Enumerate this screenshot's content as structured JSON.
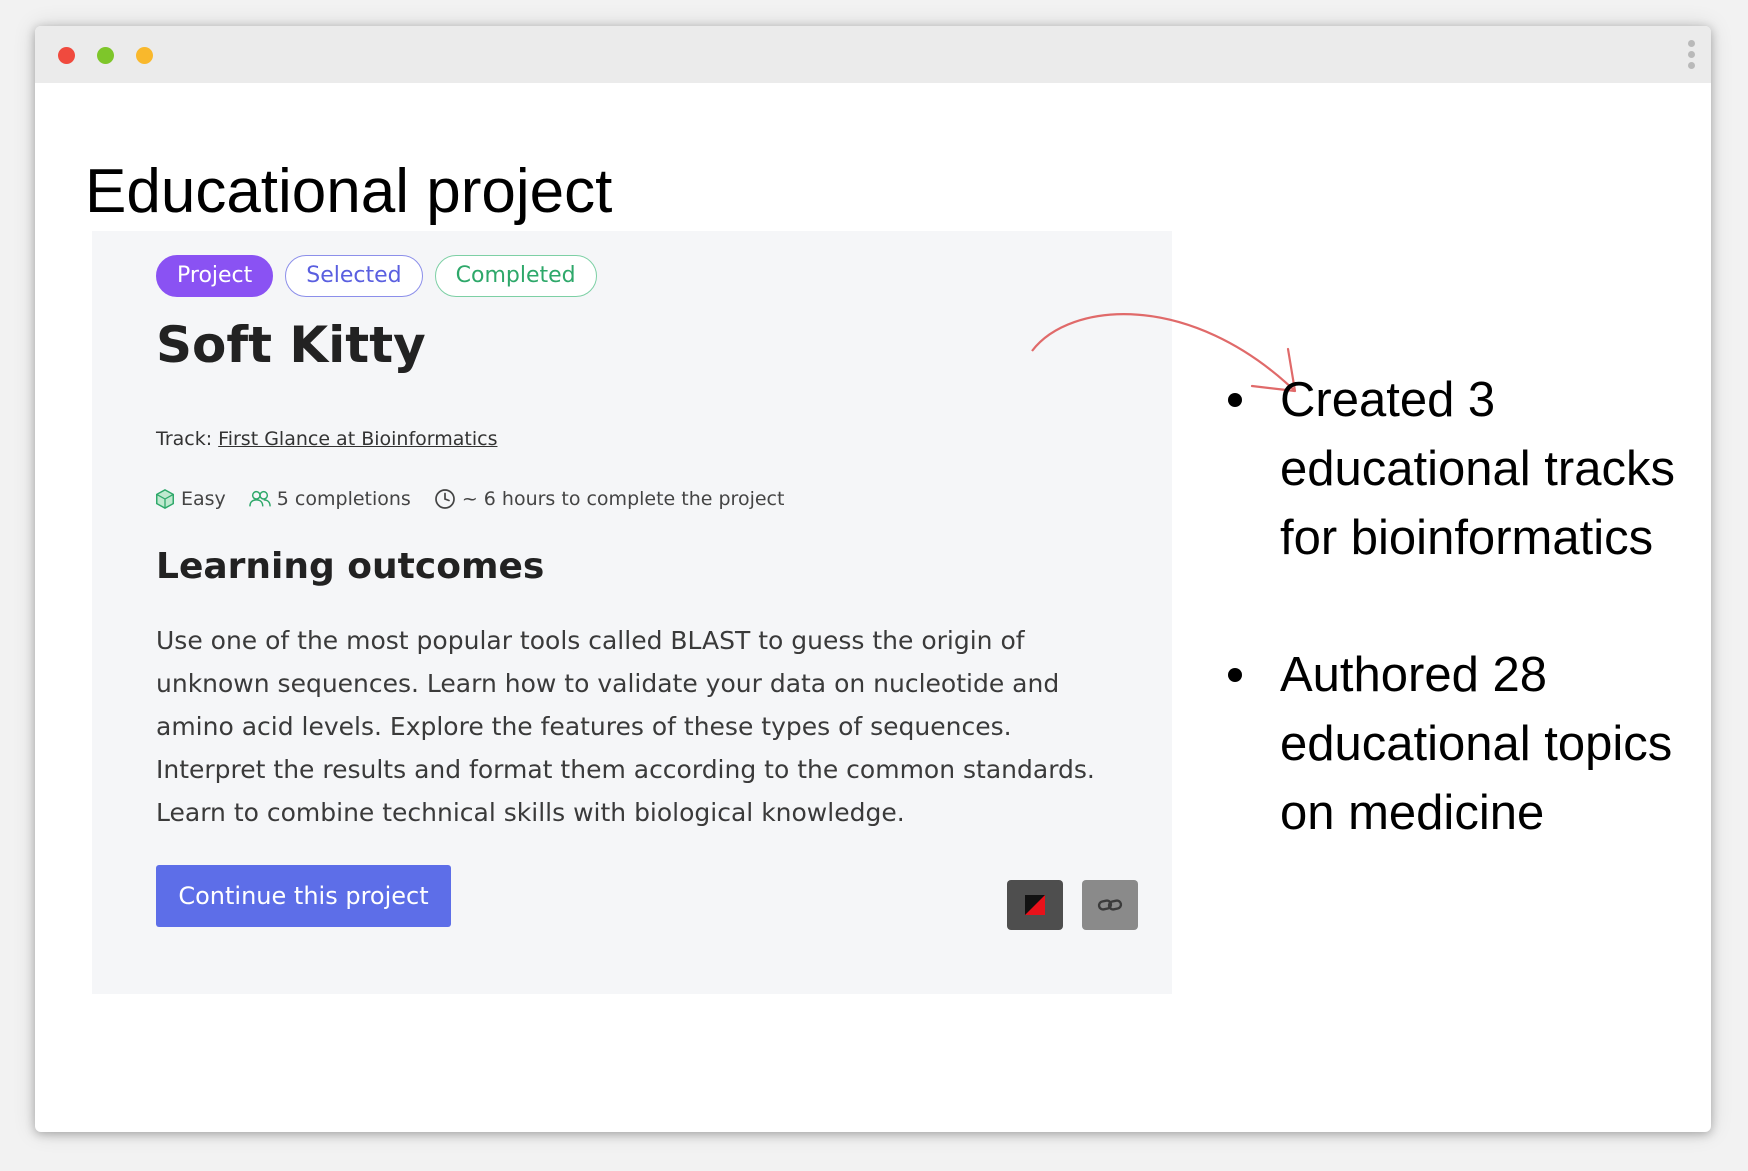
{
  "page": {
    "title": "Educational project"
  },
  "card": {
    "badges": [
      "Project",
      "Selected",
      "Completed"
    ],
    "title": "Soft Kitty",
    "track_label": "Track:",
    "track_link": "First Glance at Bioinformatics",
    "meta": {
      "difficulty": "Easy",
      "completions": "5 completions",
      "duration": "~ 6 hours to complete the project"
    },
    "outcomes_heading": "Learning outcomes",
    "outcomes_text": "Use one of the most popular tools called BLAST to guess the origin of unknown sequences. Learn how to validate your data on nucleotide and amino acid levels. Explore the features of these types of sequences. Interpret the results and format them according to the common standards. Learn to combine technical skills with biological knowledge.",
    "continue_button": "Continue this project"
  },
  "bullets": [
    "Created 3 educational tracks for bioinformatics",
    "Authored 28 educational topics on medicine"
  ],
  "colors": {
    "accent": "#5d6ee8",
    "project_badge": "#8a52f3",
    "completed_green": "#2ea86a",
    "arrow": "#e06a6a"
  }
}
